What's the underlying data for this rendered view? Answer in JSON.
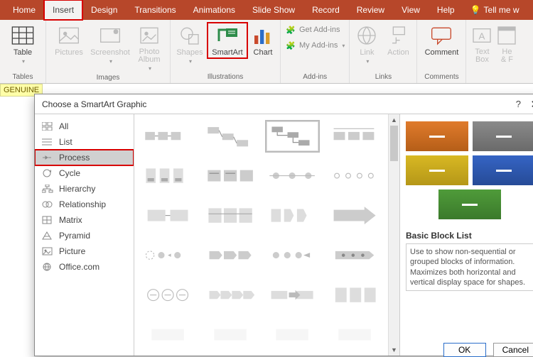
{
  "ribbon": {
    "tabs": [
      "Home",
      "Insert",
      "Design",
      "Transitions",
      "Animations",
      "Slide Show",
      "Record",
      "Review",
      "View",
      "Help"
    ],
    "active_tab": "Insert",
    "tellme": "Tell me w",
    "groups": {
      "tables": {
        "label": "Tables",
        "table": "Table"
      },
      "images": {
        "label": "Images",
        "pictures": "Pictures",
        "screenshot": "Screenshot",
        "photo_album": "Photo\nAlbum"
      },
      "illustrations": {
        "label": "Illustrations",
        "shapes": "Shapes",
        "smartart": "SmartArt",
        "chart": "Chart"
      },
      "addins": {
        "label": "Add-ins",
        "get": "Get Add-ins",
        "my": "My Add-ins"
      },
      "links": {
        "label": "Links",
        "link": "Link",
        "action": "Action"
      },
      "comments": {
        "label": "Comments",
        "comment": "Comment"
      },
      "text": {
        "textbox": "Text\nBox",
        "header": "He\n& F"
      }
    }
  },
  "status": {
    "genuine": "GENUINE"
  },
  "dialog": {
    "title": "Choose a SmartArt Graphic",
    "categories": [
      "All",
      "List",
      "Process",
      "Cycle",
      "Hierarchy",
      "Relationship",
      "Matrix",
      "Pyramid",
      "Picture",
      "Office.com"
    ],
    "selected_category": "Process",
    "preview": {
      "colors": [
        "#e07b2c",
        "#8a8a8a",
        "#d8b823",
        "#3564c4",
        "#4f9b3a"
      ],
      "title": "Basic Block List",
      "desc": "Use to show non-sequential or grouped blocks of information. Maximizes both horizontal and vertical display space for shapes."
    },
    "buttons": {
      "ok": "OK",
      "cancel": "Cancel"
    }
  }
}
